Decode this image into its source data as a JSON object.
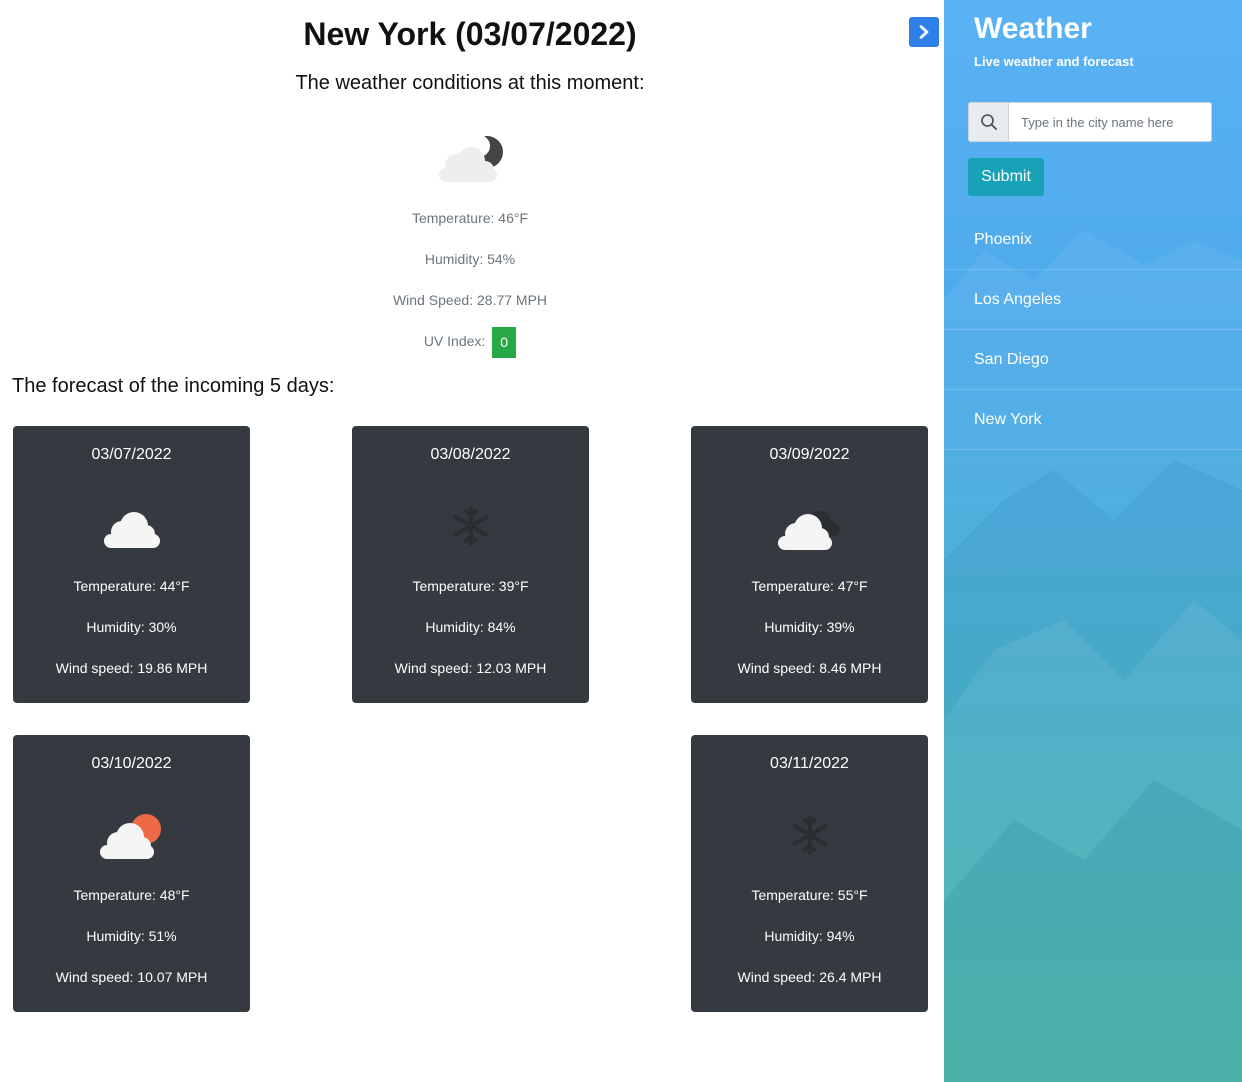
{
  "current": {
    "title": "New York (03/07/2022)",
    "subtitle": "The weather conditions at this moment:",
    "icon": "cloud-night-icon",
    "temperature": "Temperature: 46°F",
    "humidity": "Humidity: 54%",
    "wind": "Wind Speed: 28.77 MPH",
    "uv_label": "UV Index:",
    "uv_value": "0",
    "uv_color": "#28a745"
  },
  "forecast": {
    "title": "The forecast of the incoming 5 days:",
    "days": [
      {
        "date": "03/07/2022",
        "icon": "cloud-icon",
        "temperature": "Temperature: 44°F",
        "humidity": "Humidity: 30%",
        "wind": "Wind speed: 19.86 MPH"
      },
      {
        "date": "03/08/2022",
        "icon": "snowflake-icon",
        "temperature": "Temperature: 39°F",
        "humidity": "Humidity: 84%",
        "wind": "Wind speed: 12.03 MPH"
      },
      {
        "date": "03/09/2022",
        "icon": "cloudy-icon",
        "temperature": "Temperature: 47°F",
        "humidity": "Humidity: 39%",
        "wind": "Wind speed: 8.46 MPH"
      },
      {
        "date": "03/10/2022",
        "icon": "partly-sunny-icon",
        "temperature": "Temperature: 48°F",
        "humidity": "Humidity: 51%",
        "wind": "Wind speed: 10.07 MPH"
      },
      {
        "date": "03/11/2022",
        "icon": "snowflake-icon",
        "temperature": "Temperature: 55°F",
        "humidity": "Humidity: 94%",
        "wind": "Wind speed: 26.4 MPH"
      }
    ]
  },
  "sidebar": {
    "title": "Weather",
    "subtitle": "Live weather and forecast",
    "search_placeholder": "Type in the city name here",
    "submit_label": "Submit",
    "history": [
      "Phoenix",
      "Los Angeles",
      "San Diego",
      "New York"
    ]
  },
  "colors": {
    "card_bg": "#343a40",
    "toggle_button": "#2f7fe8",
    "submit_button": "#17a2b8",
    "sun": "#ee6a47",
    "moon": "#444444"
  }
}
